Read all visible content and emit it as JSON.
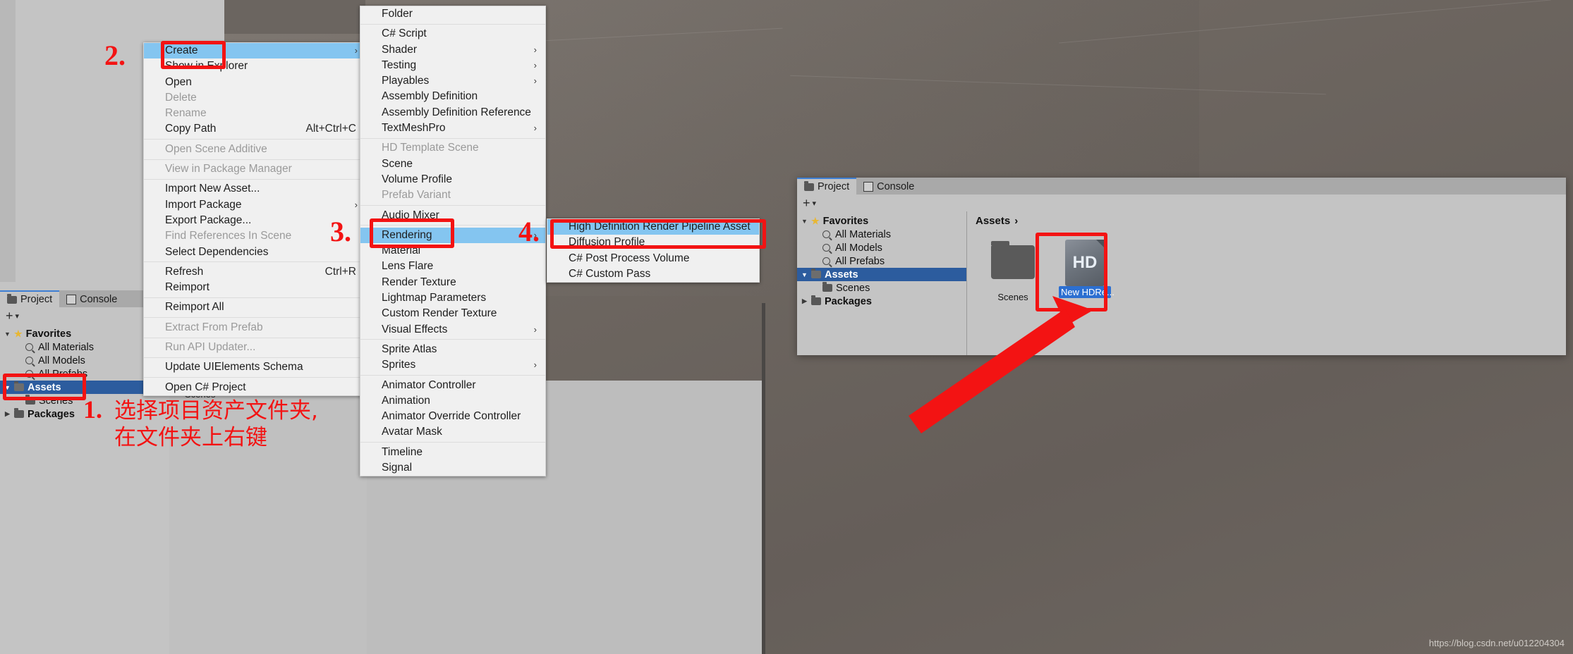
{
  "window": {
    "watermark": "https://blog.csdn.net/u012204304"
  },
  "context_menu": {
    "name": "asset-context-menu",
    "items": [
      {
        "label": "Create",
        "state": "selected",
        "submenu": true,
        "shortcut": ""
      },
      {
        "label": "Show in Explorer",
        "state": "normal",
        "submenu": false,
        "shortcut": ""
      },
      {
        "label": "Open",
        "state": "normal",
        "submenu": false,
        "shortcut": ""
      },
      {
        "label": "Delete",
        "state": "disabled",
        "submenu": false,
        "shortcut": ""
      },
      {
        "label": "Rename",
        "state": "disabled",
        "submenu": false,
        "shortcut": ""
      },
      {
        "label": "Copy Path",
        "state": "normal",
        "submenu": false,
        "shortcut": "Alt+Ctrl+C"
      },
      {
        "separator": true
      },
      {
        "label": "Open Scene Additive",
        "state": "disabled",
        "submenu": false,
        "shortcut": ""
      },
      {
        "separator": true
      },
      {
        "label": "View in Package Manager",
        "state": "disabled",
        "submenu": false,
        "shortcut": ""
      },
      {
        "separator": true
      },
      {
        "label": "Import New Asset...",
        "state": "normal",
        "submenu": false,
        "shortcut": ""
      },
      {
        "label": "Import Package",
        "state": "normal",
        "submenu": true,
        "shortcut": ""
      },
      {
        "label": "Export Package...",
        "state": "normal",
        "submenu": false,
        "shortcut": ""
      },
      {
        "label": "Find References In Scene",
        "state": "disabled",
        "submenu": false,
        "shortcut": ""
      },
      {
        "label": "Select Dependencies",
        "state": "normal",
        "submenu": false,
        "shortcut": ""
      },
      {
        "separator": true
      },
      {
        "label": "Refresh",
        "state": "normal",
        "submenu": false,
        "shortcut": "Ctrl+R"
      },
      {
        "label": "Reimport",
        "state": "normal",
        "submenu": false,
        "shortcut": ""
      },
      {
        "separator": true
      },
      {
        "label": "Reimport All",
        "state": "normal",
        "submenu": false,
        "shortcut": ""
      },
      {
        "separator": true
      },
      {
        "label": "Extract From Prefab",
        "state": "disabled",
        "submenu": false,
        "shortcut": ""
      },
      {
        "separator": true
      },
      {
        "label": "Run API Updater...",
        "state": "disabled",
        "submenu": false,
        "shortcut": ""
      },
      {
        "separator": true
      },
      {
        "label": "Update UIElements Schema",
        "state": "normal",
        "submenu": false,
        "shortcut": ""
      },
      {
        "separator": true
      },
      {
        "label": "Open C# Project",
        "state": "normal",
        "submenu": false,
        "shortcut": ""
      }
    ]
  },
  "create_menu": {
    "name": "create-submenu",
    "items": [
      {
        "label": "Folder",
        "state": "normal",
        "submenu": false
      },
      {
        "separator": true
      },
      {
        "label": "C# Script",
        "state": "normal",
        "submenu": false
      },
      {
        "label": "Shader",
        "state": "normal",
        "submenu": true
      },
      {
        "label": "Testing",
        "state": "normal",
        "submenu": true
      },
      {
        "label": "Playables",
        "state": "normal",
        "submenu": true
      },
      {
        "label": "Assembly Definition",
        "state": "normal",
        "submenu": false
      },
      {
        "label": "Assembly Definition Reference",
        "state": "normal",
        "submenu": false
      },
      {
        "label": "TextMeshPro",
        "state": "normal",
        "submenu": true
      },
      {
        "separator": true
      },
      {
        "label": "HD Template Scene",
        "state": "disabled",
        "submenu": false
      },
      {
        "label": "Scene",
        "state": "normal",
        "submenu": false
      },
      {
        "label": "Volume Profile",
        "state": "normal",
        "submenu": false
      },
      {
        "label": "Prefab Variant",
        "state": "disabled",
        "submenu": false
      },
      {
        "separator": true
      },
      {
        "label": "Audio Mixer",
        "state": "normal",
        "submenu": false
      },
      {
        "separator": true
      },
      {
        "label": "Rendering",
        "state": "selected",
        "submenu": true
      },
      {
        "label": "Material",
        "state": "normal",
        "submenu": false
      },
      {
        "label": "Lens Flare",
        "state": "normal",
        "submenu": false
      },
      {
        "label": "Render Texture",
        "state": "normal",
        "submenu": false
      },
      {
        "label": "Lightmap Parameters",
        "state": "normal",
        "submenu": false
      },
      {
        "label": "Custom Render Texture",
        "state": "normal",
        "submenu": false
      },
      {
        "label": "Visual Effects",
        "state": "normal",
        "submenu": true
      },
      {
        "separator": true
      },
      {
        "label": "Sprite Atlas",
        "state": "normal",
        "submenu": false
      },
      {
        "label": "Sprites",
        "state": "normal",
        "submenu": true
      },
      {
        "separator": true
      },
      {
        "label": "Animator Controller",
        "state": "normal",
        "submenu": false
      },
      {
        "label": "Animation",
        "state": "normal",
        "submenu": false
      },
      {
        "label": "Animator Override Controller",
        "state": "normal",
        "submenu": false
      },
      {
        "label": "Avatar Mask",
        "state": "normal",
        "submenu": false
      },
      {
        "separator": true
      },
      {
        "label": "Timeline",
        "state": "normal",
        "submenu": false
      },
      {
        "label": "Signal",
        "state": "normal",
        "submenu": false
      }
    ]
  },
  "rendering_menu": {
    "name": "rendering-submenu",
    "items": [
      {
        "label": "High Definition Render Pipeline Asset",
        "state": "selected",
        "submenu": false
      },
      {
        "label": "Diffusion Profile",
        "state": "normal",
        "submenu": false
      },
      {
        "label": "C# Post Process Volume",
        "state": "normal",
        "submenu": false
      },
      {
        "label": "C# Custom Pass",
        "state": "normal",
        "submenu": false
      }
    ]
  },
  "project_panel_left": {
    "tabs": [
      {
        "label": "Project",
        "icon": "folder-icon",
        "active": true
      },
      {
        "label": "Console",
        "icon": "console-icon",
        "active": false
      }
    ],
    "add_button": "+",
    "dropdown_caret": "▾",
    "tree": [
      {
        "label": "Favorites",
        "icon": "star-icon",
        "arrow": "▼",
        "indent": 0,
        "bold": true,
        "selected": false
      },
      {
        "label": "All Materials",
        "icon": "search-icon",
        "arrow": "",
        "indent": 1,
        "bold": false,
        "selected": false
      },
      {
        "label": "All Models",
        "icon": "search-icon",
        "arrow": "",
        "indent": 1,
        "bold": false,
        "selected": false
      },
      {
        "label": "All Prefabs",
        "icon": "search-icon",
        "arrow": "",
        "indent": 1,
        "bold": false,
        "selected": false
      },
      {
        "label": "Assets",
        "icon": "folder-open-icon",
        "arrow": "▼",
        "indent": 0,
        "bold": true,
        "selected": true
      },
      {
        "label": "Scenes",
        "icon": "folder-icon",
        "arrow": "",
        "indent": 1,
        "bold": false,
        "selected": false
      },
      {
        "label": "Packages",
        "icon": "folder-icon",
        "arrow": "▶",
        "indent": 0,
        "bold": true,
        "selected": false
      }
    ],
    "grid_label": "Scenes"
  },
  "project_panel_right": {
    "tabs": [
      {
        "label": "Project",
        "icon": "folder-icon",
        "active": true
      },
      {
        "label": "Console",
        "icon": "console-icon",
        "active": false
      }
    ],
    "add_button": "+",
    "dropdown_caret": "▾",
    "tree": [
      {
        "label": "Favorites",
        "icon": "star-icon",
        "arrow": "▼",
        "indent": 0,
        "bold": true,
        "selected": false
      },
      {
        "label": "All Materials",
        "icon": "search-icon",
        "arrow": "",
        "indent": 1,
        "bold": false,
        "selected": false
      },
      {
        "label": "All Models",
        "icon": "search-icon",
        "arrow": "",
        "indent": 1,
        "bold": false,
        "selected": false
      },
      {
        "label": "All Prefabs",
        "icon": "search-icon",
        "arrow": "",
        "indent": 1,
        "bold": false,
        "selected": false
      },
      {
        "label": "Assets",
        "icon": "folder-open-icon",
        "arrow": "▼",
        "indent": 0,
        "bold": true,
        "selected": true
      },
      {
        "label": "Scenes",
        "icon": "folder-icon",
        "arrow": "",
        "indent": 1,
        "bold": false,
        "selected": false
      },
      {
        "label": "Packages",
        "icon": "folder-icon",
        "arrow": "▶",
        "indent": 0,
        "bold": true,
        "selected": false
      }
    ],
    "breadcrumb": "Assets",
    "breadcrumb_caret": "›",
    "assets": [
      {
        "label": "Scenes",
        "type": "folder",
        "selected": false,
        "badge": ""
      },
      {
        "label": "New HDRe...",
        "type": "hdrp-asset",
        "selected": true,
        "badge": "HD"
      }
    ]
  },
  "annotations": {
    "step1": "1.",
    "step2": "2.",
    "step3": "3.",
    "step4": "4.",
    "chinese_note_line1": "选择项目资产文件夹,",
    "chinese_note_line2": "在文件夹上右键",
    "accent_color": "#f31313",
    "highlight_color": "#84c5f0",
    "selection_color": "#2c5c9e"
  }
}
